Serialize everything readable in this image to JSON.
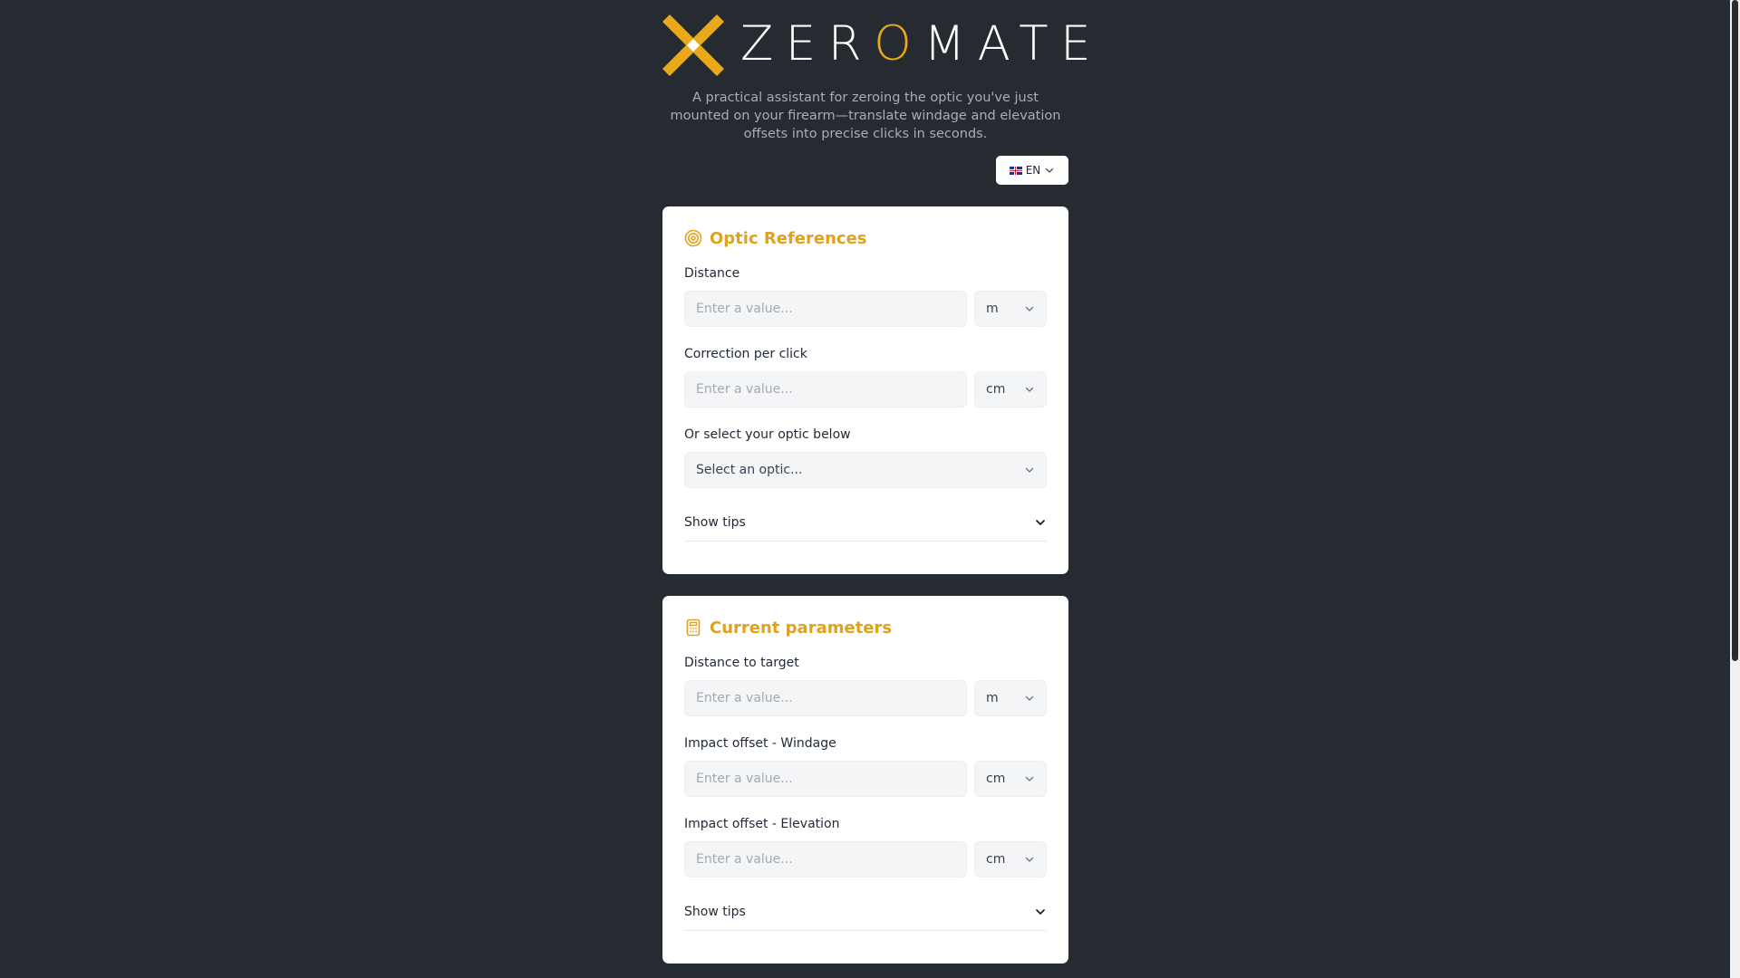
{
  "brand": {
    "name_before": "ZER",
    "name_accent": "O",
    "name_after": "MATE",
    "accent_color": "#eaa91b",
    "logo_icon": "x-mark-logo"
  },
  "tagline": "A practical assistant for zeroing the optic you've just mounted on your firearm—translate windage and elevation offsets into precise clicks in seconds.",
  "language": {
    "flag_icon": "uk-flag-icon",
    "label": "EN"
  },
  "optic_card": {
    "title": "Optic References",
    "icon": "target-icon",
    "distance": {
      "label": "Distance",
      "placeholder": "Enter a value...",
      "unit": "m"
    },
    "correction": {
      "label": "Correction per click",
      "placeholder": "Enter a value...",
      "unit": "cm"
    },
    "optic_select": {
      "label": "Or select your optic below",
      "placeholder": "Select an optic..."
    },
    "tips_label": "Show tips"
  },
  "params_card": {
    "title": "Current parameters",
    "icon": "calculator-icon",
    "distance_target": {
      "label": "Distance to target",
      "placeholder": "Enter a value...",
      "unit": "m"
    },
    "windage": {
      "label": "Impact offset - Windage",
      "placeholder": "Enter a value...",
      "unit": "cm"
    },
    "elevation": {
      "label": "Impact offset - Elevation",
      "placeholder": "Enter a value...",
      "unit": "cm"
    },
    "tips_label": "Show tips"
  }
}
